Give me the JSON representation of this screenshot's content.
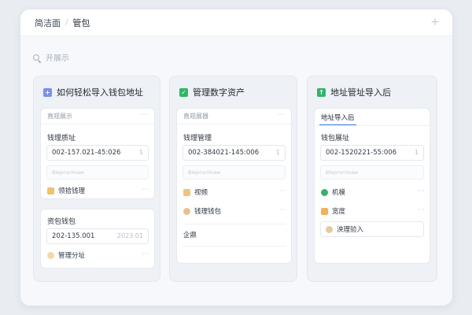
{
  "window": {
    "breadcrumb": [
      "简洁面",
      "管包"
    ],
    "add_tab": "+"
  },
  "search": {
    "placeholder": "开展示"
  },
  "columns": [
    {
      "title": "如何轻松导入钱包地址",
      "icon": "plus-square-icon",
      "icon_glyph": "+",
      "icon_color": "#7b8ff0",
      "panel1": {
        "header": "直观展示",
        "label": "钱理质址",
        "field_value": "002-157.021-45:026",
        "field_right": "1",
        "ghost": "Bleprorimaw",
        "row": "领拾钱理"
      },
      "panel2": {
        "label": "资包钱包",
        "field_value": "202-135.001",
        "field_right": "2023.01",
        "row": "管理分址"
      }
    },
    {
      "title": "管理数字资产",
      "icon": "check-square-icon",
      "icon_glyph": "✓",
      "icon_color": "#2fb567",
      "panel1": {
        "header": "直观展器",
        "label": "钱理管理",
        "field_value": "002-384021-145:006",
        "field_right": "1",
        "ghost": "Bleprorimaw",
        "row1": "视频",
        "row2": "钱理钱包",
        "row3": "企鼎"
      }
    },
    {
      "title": "地址管址导入后",
      "icon": "upload-square-icon",
      "icon_glyph": "↑",
      "icon_color": "#36b26a",
      "panel1": {
        "tab": "地址导入后",
        "label": "钱包展址",
        "field_value": "002-1520221-55:006",
        "field_right": "1",
        "ghost": "Bleprorimaw",
        "row1": "机模",
        "row2": "宽度",
        "row3": "泱理验入"
      }
    }
  ],
  "more": "···",
  "colors": {
    "accent": "#3b7be8",
    "green": "#36b26a",
    "orange": "#f0b25a",
    "purple": "#7b8ff0"
  }
}
